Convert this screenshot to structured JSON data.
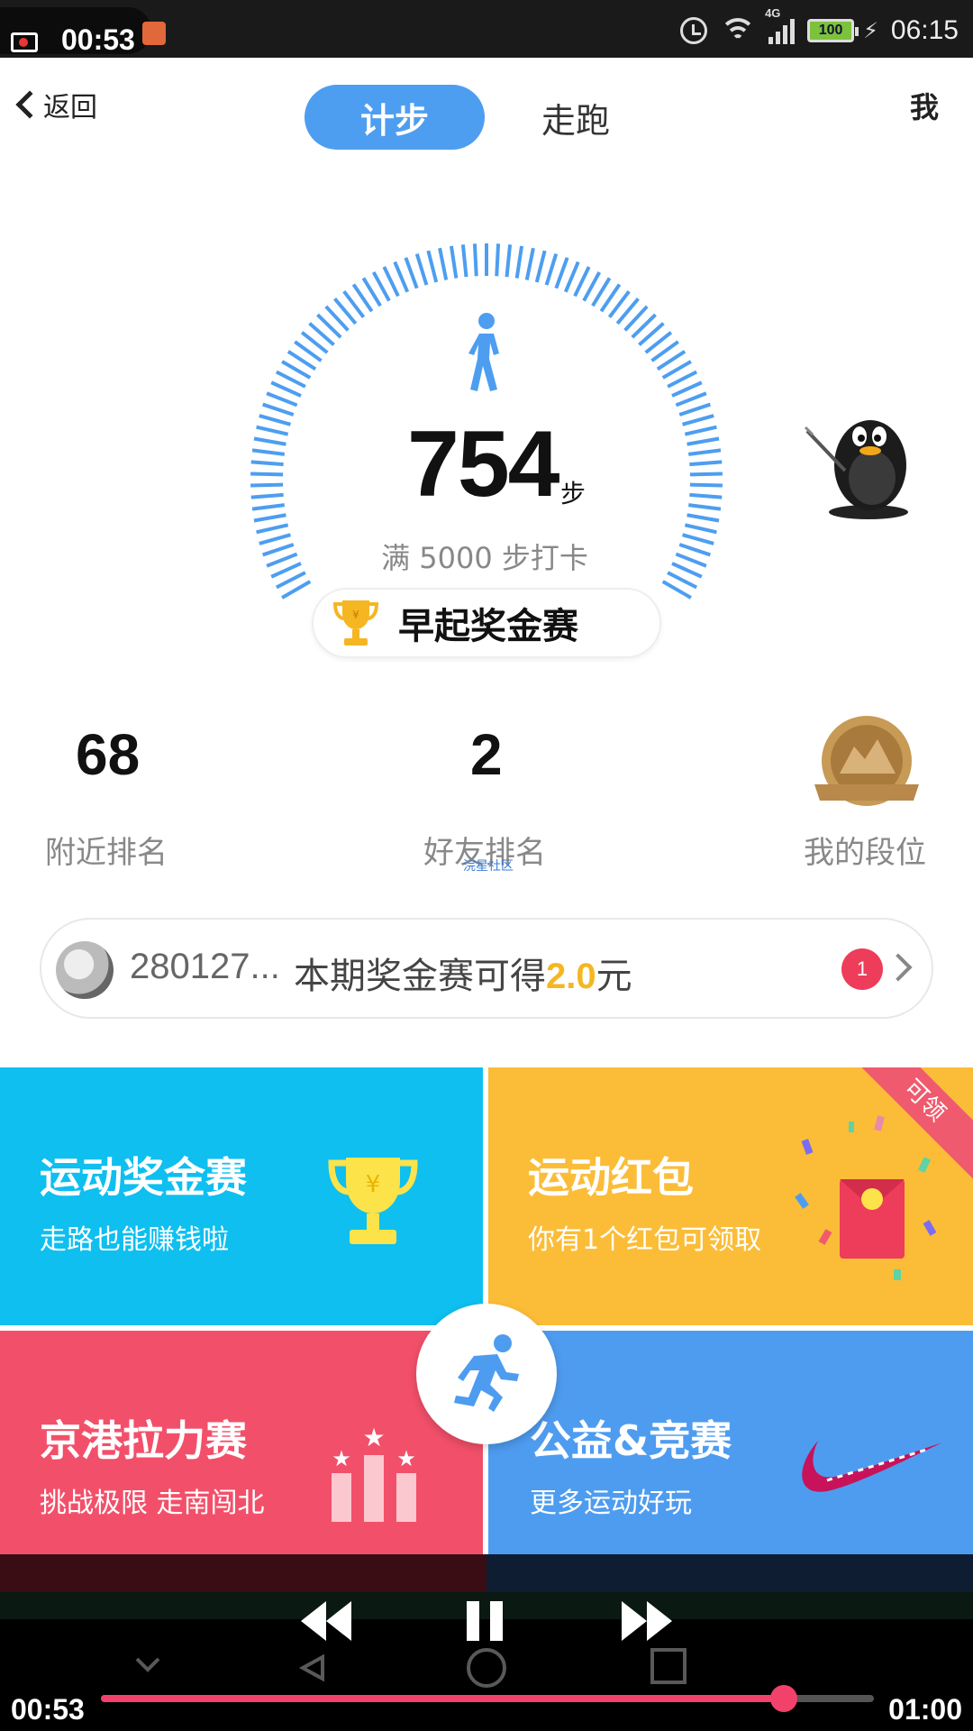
{
  "status_bar": {
    "recording_time": "00:53",
    "network_label": "4G",
    "battery_level": "100",
    "clock": "06:15"
  },
  "header": {
    "back_label": "返回",
    "tabs": [
      {
        "label": "计步",
        "active": true
      },
      {
        "label": "走跑",
        "active": false
      }
    ],
    "me_label": "我"
  },
  "step_counter": {
    "steps": "754",
    "unit": "步",
    "target_text": "满 5000 步打卡",
    "tournament_label": "早起奖金赛",
    "accent_color": "#4d9ef0"
  },
  "stats": [
    {
      "value": "68",
      "label": "附近排名"
    },
    {
      "value": "2",
      "label": "好友排名"
    },
    {
      "value": "",
      "label": "我的段位"
    }
  ],
  "watermark": "浣星社区",
  "reward_banner": {
    "user_name": "280127...",
    "message_prefix": "本期奖金赛可得",
    "amount": "2.0",
    "message_suffix": "元",
    "badge_count": "1"
  },
  "cards": [
    {
      "title": "运动奖金赛",
      "subtitle": "走路也能赚钱啦",
      "color": "#0ebff0",
      "icon": "trophy-icon"
    },
    {
      "title": "运动红包",
      "subtitle": "你有1个红包可领取",
      "color": "#fbbd38",
      "icon": "red-envelope-icon",
      "corner_label": "可领"
    },
    {
      "title": "京港拉力赛",
      "subtitle": "挑战极限 走南闯北",
      "color": "#f2506a",
      "icon": "podium-stars-icon"
    },
    {
      "title": "公益&竞赛",
      "subtitle": "更多运动好玩",
      "color": "#4e9cf0",
      "icon": "swoosh-icon"
    }
  ],
  "player": {
    "current_time": "00:53",
    "total_time": "01:00",
    "progress": 0.8833
  }
}
